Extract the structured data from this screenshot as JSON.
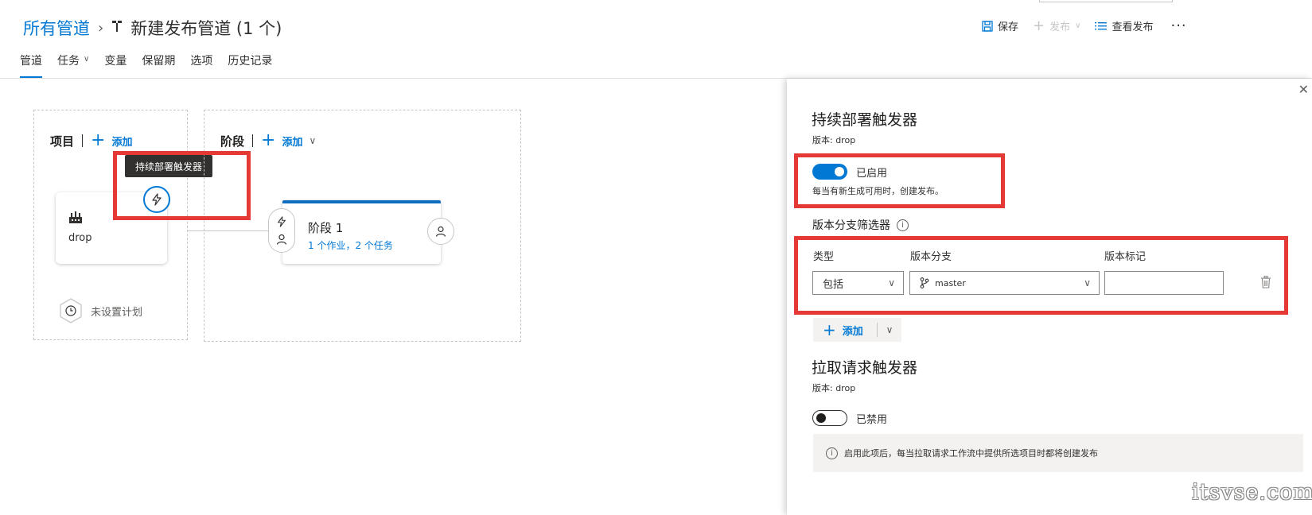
{
  "breadcrumb": {
    "root": "所有管道",
    "separator": "›",
    "title": "新建发布管道 (1 个)"
  },
  "toolbar": {
    "save_label": "保存",
    "release_label": "发布",
    "view_releases_label": "查看发布",
    "more_label": "···"
  },
  "tabs": [
    {
      "label": "管道",
      "active": true
    },
    {
      "label": "任务",
      "has_dropdown": true
    },
    {
      "label": "变量"
    },
    {
      "label": "保留期"
    },
    {
      "label": "选项"
    },
    {
      "label": "历史记录"
    }
  ],
  "canvas": {
    "artifacts": {
      "title": "项目",
      "add_label": "添加",
      "artifact_name": "drop",
      "trigger_tooltip": "持续部署触发器",
      "schedule_label": "未设置计划"
    },
    "stages": {
      "title": "阶段",
      "add_label": "添加",
      "stage_name": "阶段 1",
      "stage_summary": "1 个作业，2 个任务"
    }
  },
  "panel": {
    "cd_trigger": {
      "title": "持续部署触发器",
      "subtitle": "版本: drop",
      "toggle_label": "已启用",
      "enabled": true,
      "description": "每当有新生成可用时，创建发布。"
    },
    "branch_filters": {
      "title": "版本分支筛选器",
      "columns": {
        "type": "类型",
        "branch": "版本分支",
        "tags": "版本标记"
      },
      "row": {
        "type": "包括",
        "branch": "master",
        "tags": ""
      },
      "add_label": "添加"
    },
    "pr_trigger": {
      "title": "拉取请求触发器",
      "subtitle": "版本: drop",
      "toggle_label": "已禁用",
      "enabled": false,
      "info": "启用此项后，每当拉取请求工作流中提供所选项目时都将创建发布"
    }
  },
  "watermark": "itsvse.com",
  "colors": {
    "accent": "#0078d4",
    "highlight_red": "#e53935"
  }
}
